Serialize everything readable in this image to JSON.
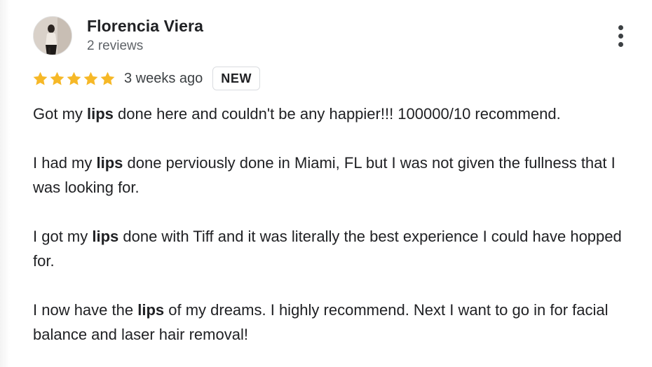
{
  "reviewer": {
    "name": "Florencia Viera",
    "review_count": "2 reviews"
  },
  "rating": {
    "stars": 5,
    "max_stars": 5,
    "color": "#f6b827",
    "time_ago": "3 weeks ago",
    "badge": "NEW"
  },
  "review": {
    "p1": {
      "before": "Got my ",
      "highlight": "lips",
      "after": " done here and couldn't be any happier!!! 100000/10 recommend."
    },
    "p2": {
      "before": "I had my ",
      "highlight": "lips",
      "after": " done perviously done in Miami, FL but I was not given the fullness that I was looking for."
    },
    "p3": {
      "before": "I got my ",
      "highlight": "lips",
      "after": " done with Tiff and it was literally the best experience I could have hopped for."
    },
    "p4": {
      "before": "I now have the ",
      "highlight": "lips",
      "after": " of my dreams. I highly recommend. Next I want to go in for facial balance and laser hair removal!"
    }
  },
  "icons": {
    "more": "more-vert-icon",
    "star": "star-icon"
  }
}
